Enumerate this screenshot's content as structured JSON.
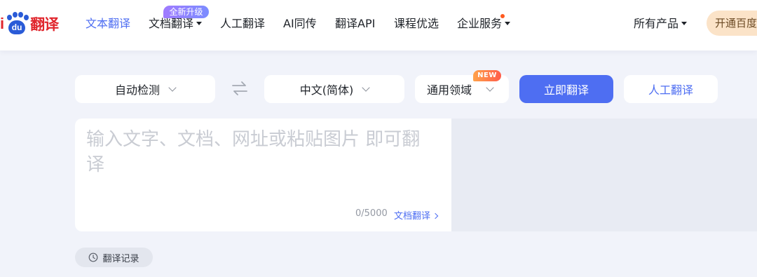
{
  "logo": {
    "prefix": "i",
    "paw_text": "du",
    "word": "翻译"
  },
  "nav": {
    "items": [
      {
        "label": "文本翻译"
      },
      {
        "label": "文档翻译"
      },
      {
        "label": "人工翻译"
      },
      {
        "label": "AI同传"
      },
      {
        "label": "翻译API"
      },
      {
        "label": "课程优选"
      },
      {
        "label": "企业服务"
      }
    ],
    "upgrade_badge": "全新升级",
    "all_products": "所有产品",
    "vip_button": "开通百度翻"
  },
  "toolbar": {
    "source_lang": "自动检测",
    "target_lang": "中文(简体)",
    "domain": "通用领域",
    "new_badge": "NEW",
    "translate_button": "立即翻译",
    "human_button": "人工翻译"
  },
  "editor": {
    "placeholder": "输入文字、文档、网址或粘贴图片 即可翻译",
    "counter": "0/5000",
    "doc_link": "文档翻译"
  },
  "history": {
    "label": "翻译记录"
  },
  "colors": {
    "accent": "#4e6ef2",
    "brand_red": "#e0262d",
    "brand_blue": "#2a5bd7",
    "background": "#f1f3fa"
  }
}
